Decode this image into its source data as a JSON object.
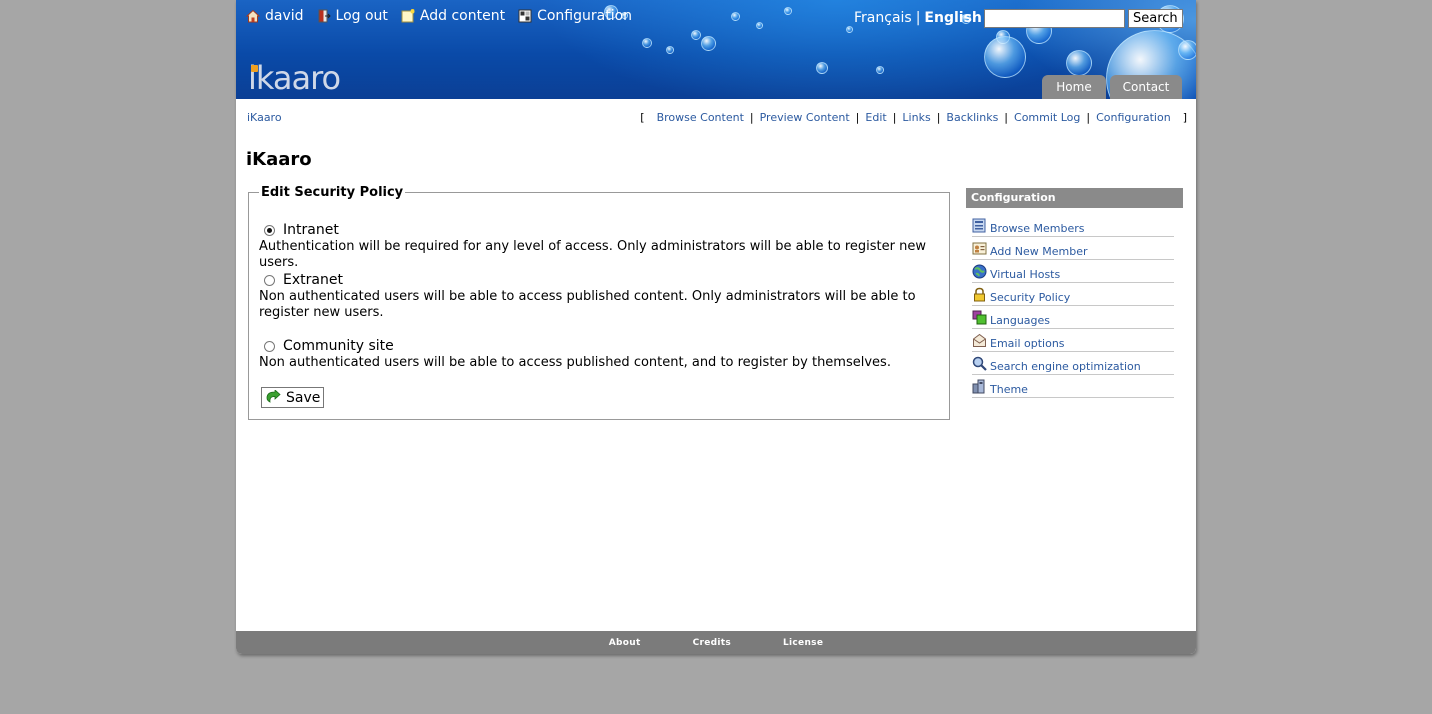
{
  "user_bar": {
    "user": "david",
    "logout": "Log out",
    "add_content": "Add content",
    "configuration": "Configuration"
  },
  "languages": [
    "Français",
    "English"
  ],
  "active_language": "English",
  "search": {
    "button": "Search",
    "value": ""
  },
  "logo": {
    "text": "ikaaro"
  },
  "tabs": [
    "Home",
    "Contact"
  ],
  "breadcrumb": "iKaaro",
  "actions": [
    "Browse Content",
    "Preview Content",
    "Edit",
    "Links",
    "Backlinks",
    "Commit Log",
    "Configuration"
  ],
  "title": "iKaaro",
  "policy": {
    "legend": "Edit Security Policy",
    "options": [
      {
        "label": "Intranet",
        "desc": "Authentication will be required for any level of access. Only administrators will be able to register new users.",
        "checked": true
      },
      {
        "label": "Extranet",
        "desc": "Non authenticated users will be able to access published content. Only administrators will be able to register new users.",
        "checked": false
      },
      {
        "label": "Community site",
        "desc": "Non authenticated users will be able to access published content, and to register by themselves.",
        "checked": false
      }
    ],
    "save": "Save"
  },
  "config_panel": {
    "title": "Configuration",
    "items": [
      {
        "label": "Browse Members",
        "icon": "members-icon"
      },
      {
        "label": "Add New Member",
        "icon": "add-member-icon"
      },
      {
        "label": "Virtual Hosts",
        "icon": "globe-icon"
      },
      {
        "label": "Security Policy",
        "icon": "lock-icon"
      },
      {
        "label": "Languages",
        "icon": "languages-icon"
      },
      {
        "label": "Email options",
        "icon": "envelope-icon"
      },
      {
        "label": "Search engine optimization",
        "icon": "magnifier-icon"
      },
      {
        "label": "Theme",
        "icon": "theme-icon"
      }
    ]
  },
  "footer": [
    "About",
    "Credits",
    "License"
  ],
  "colors": {
    "background": "#a6a6a6",
    "header_blue": "#0b4aa8",
    "link": "#2c5aa0",
    "tab_gray": "#8a8a8a",
    "footer_gray": "#7b7b7b"
  }
}
